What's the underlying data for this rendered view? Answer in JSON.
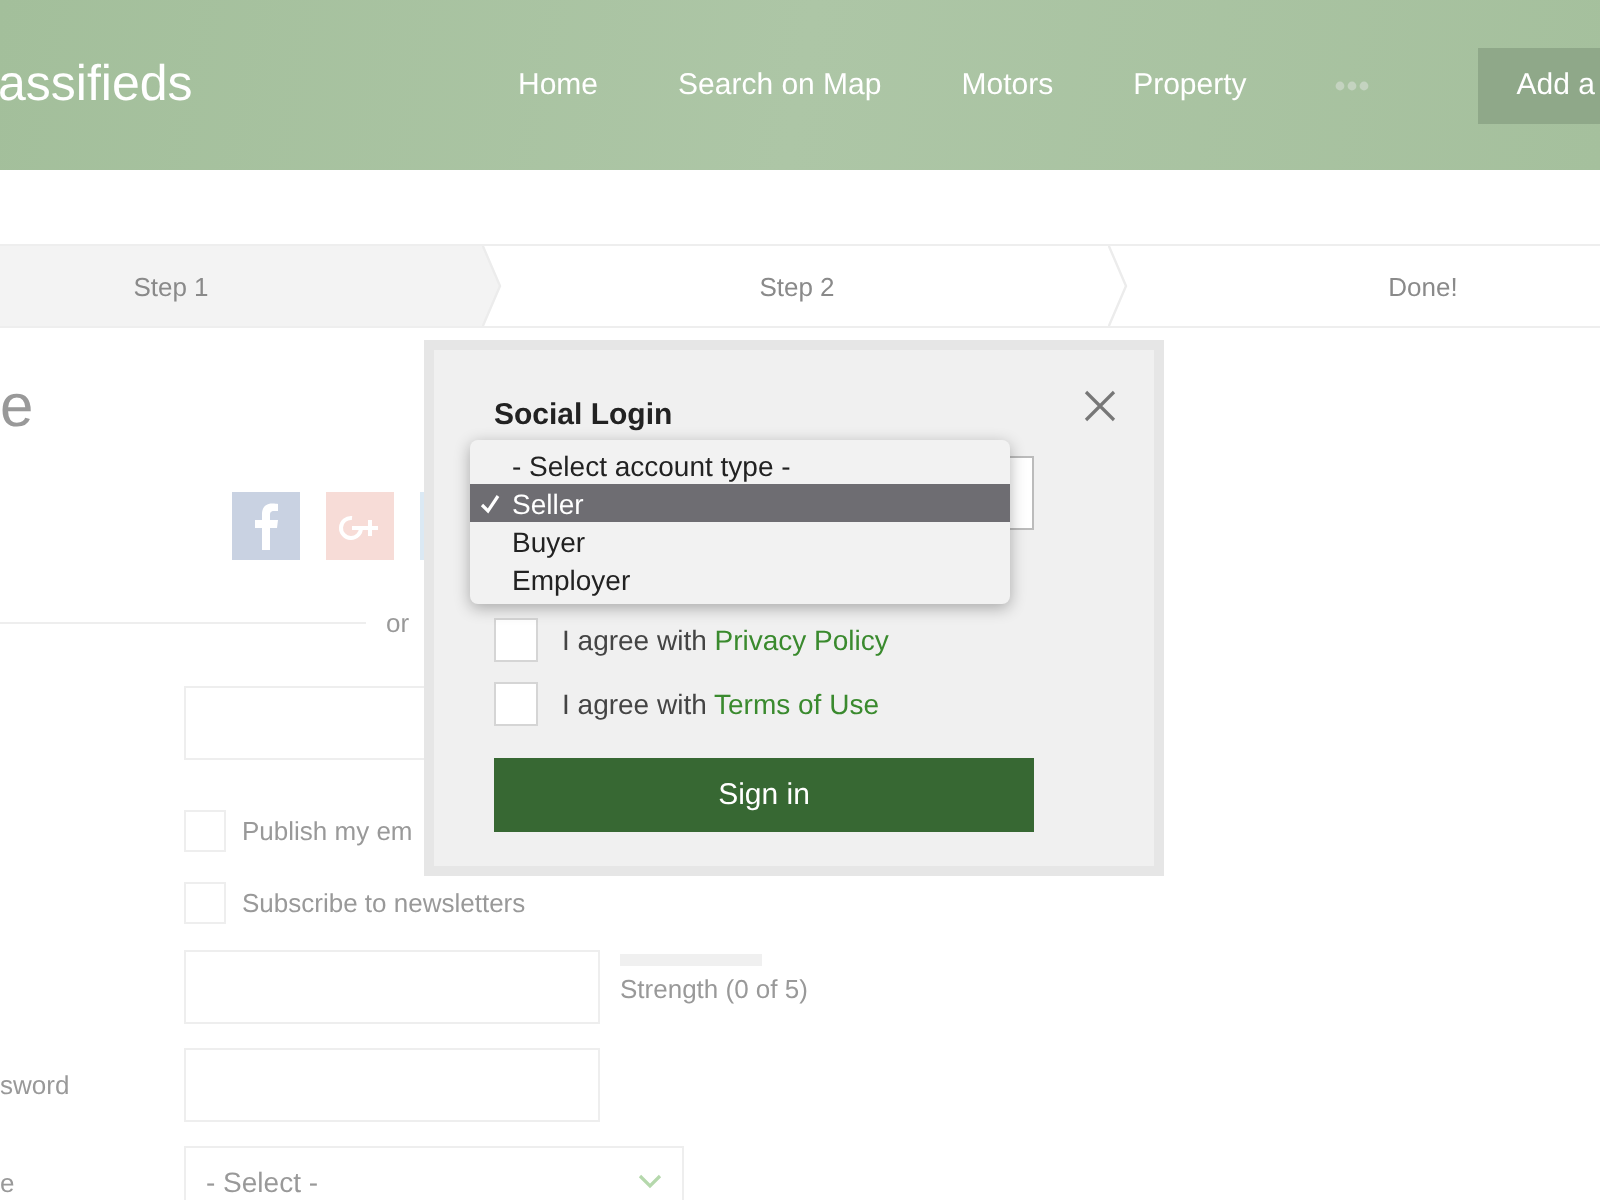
{
  "header": {
    "logo": "assifieds",
    "nav": [
      {
        "label": "Home"
      },
      {
        "label": "Search on Map"
      },
      {
        "label": "Motors"
      },
      {
        "label": "Property"
      }
    ],
    "action": "Add a"
  },
  "steps": [
    {
      "label": "Step 1",
      "selected": true
    },
    {
      "label": "Step 2",
      "selected": false
    },
    {
      "label": "Done!",
      "selected": false
    }
  ],
  "form": {
    "heading": "e",
    "divider_text": "or",
    "checkboxes": [
      {
        "label": "Publish my em",
        "checked": false
      },
      {
        "label": "Subscribe to newsletters",
        "checked": false
      }
    ],
    "strength": {
      "level": 0,
      "text": "Strength (0 of 5)"
    },
    "confirm_label": "sword",
    "select_label": "e",
    "select_value": "- Select -"
  },
  "modal": {
    "title": "Social Login",
    "dropdown": [
      {
        "label": "- Select account type -",
        "selected": false
      },
      {
        "label": "Seller",
        "selected": true
      },
      {
        "label": "Buyer",
        "selected": false
      },
      {
        "label": "Employer",
        "selected": false
      }
    ],
    "agreements": [
      {
        "prefix": "I agree with ",
        "link": "Privacy Policy",
        "checked": false
      },
      {
        "prefix": "I agree with ",
        "link": "Terms of Use",
        "checked": false
      }
    ],
    "submit": "Sign in"
  }
}
